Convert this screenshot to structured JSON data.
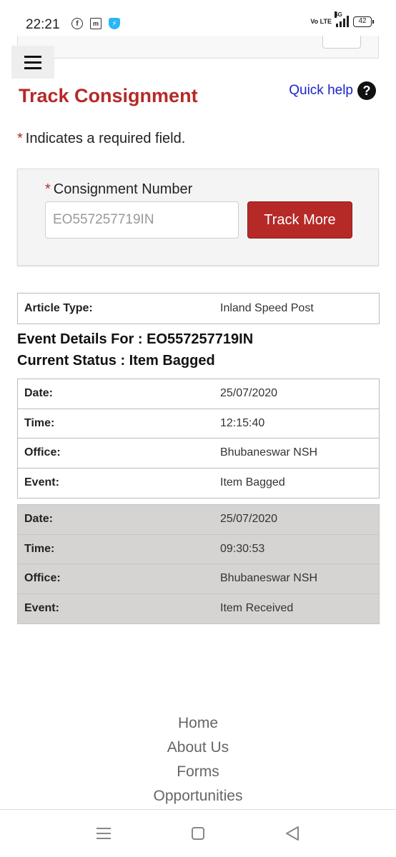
{
  "status_bar": {
    "time": "22:21",
    "network": "Vo LTE",
    "signal_type": "4G",
    "battery": "42"
  },
  "header": {
    "title": "Track Consignment",
    "quick_help": "Quick help",
    "help_icon_glyph": "?"
  },
  "form": {
    "required_star": "*",
    "required_note": "Indicates a required field.",
    "consignment_label": "Consignment Number",
    "consignment_value": "EO557257719IN",
    "track_button": "Track More"
  },
  "article": {
    "label": "Article Type:",
    "value": "Inland Speed Post"
  },
  "event_details_heading": "Event Details For : EO557257719IN",
  "current_status_heading": "Current Status : Item Bagged",
  "events": [
    {
      "rows": [
        {
          "label": "Date:",
          "value": "25/07/2020"
        },
        {
          "label": "Time:",
          "value": "12:15:40"
        },
        {
          "label": "Office:",
          "value": "Bhubaneswar NSH"
        },
        {
          "label": "Event:",
          "value": "Item Bagged"
        }
      ]
    },
    {
      "rows": [
        {
          "label": "Date:",
          "value": "25/07/2020"
        },
        {
          "label": "Time:",
          "value": "09:30:53"
        },
        {
          "label": "Office:",
          "value": "Bhubaneswar NSH"
        },
        {
          "label": "Event:",
          "value": "Item Received"
        }
      ]
    }
  ],
  "footer": {
    "links": [
      "Home",
      "About Us",
      "Forms",
      "Opportunities"
    ]
  }
}
